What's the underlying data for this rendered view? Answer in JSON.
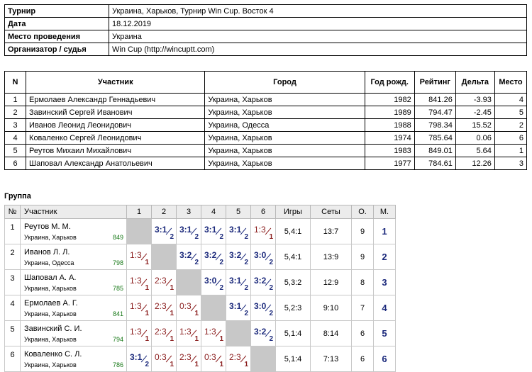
{
  "info": [
    {
      "label": "Турнир",
      "value": "Украина, Харьков, Турнир Win Cup. Восток 4"
    },
    {
      "label": "Дата",
      "value": "18.12.2019"
    },
    {
      "label": "Место проведения",
      "value": "Украина"
    },
    {
      "label": "Организатор / судья",
      "value": "Win Cup (http://wincuptt.com)"
    }
  ],
  "participants": {
    "headers": [
      "N",
      "Участник",
      "Город",
      "Год рожд.",
      "Рейтинг",
      "Дельта",
      "Место"
    ],
    "rows": [
      {
        "n": "1",
        "name": "Ермолаев Александр Геннадьевич",
        "city": "Украина, Харьков",
        "year": "1982",
        "rating": "841.26",
        "delta": "-3.93",
        "place": "4"
      },
      {
        "n": "2",
        "name": "Завинский Сергей Иванович",
        "city": "Украина, Харьков",
        "year": "1989",
        "rating": "794.47",
        "delta": "-2.45",
        "place": "5"
      },
      {
        "n": "3",
        "name": "Иванов Леонид Леонидович",
        "city": "Украина, Одесса",
        "year": "1988",
        "rating": "798.34",
        "delta": "15.52",
        "place": "2"
      },
      {
        "n": "4",
        "name": "Коваленко Сергей Леонидович",
        "city": "Украина, Харьков",
        "year": "1974",
        "rating": "785.64",
        "delta": "0.06",
        "place": "6"
      },
      {
        "n": "5",
        "name": "Реутов Михаил Михайлович",
        "city": "Украина, Харьков",
        "year": "1983",
        "rating": "849.01",
        "delta": "5.64",
        "place": "1"
      },
      {
        "n": "6",
        "name": "Шаповал Александр Анатольевич",
        "city": "Украина, Харьков",
        "year": "1977",
        "rating": "784.61",
        "delta": "12.26",
        "place": "3"
      }
    ]
  },
  "group": {
    "title": "Группа",
    "headers": [
      "№",
      "Участник",
      "1",
      "2",
      "3",
      "4",
      "5",
      "6",
      "Игры",
      "Сеты",
      "О.",
      "М."
    ],
    "rows": [
      {
        "n": "1",
        "name": "Реутов М. М.",
        "city": "Украина, Харьков",
        "rating": "849",
        "cells": [
          null,
          {
            "s": "3:1",
            "p": "2",
            "r": "win"
          },
          {
            "s": "3:1",
            "p": "2",
            "r": "win"
          },
          {
            "s": "3:1",
            "p": "2",
            "r": "win"
          },
          {
            "s": "3:1",
            "p": "2",
            "r": "win"
          },
          {
            "s": "1:3",
            "p": "1",
            "r": "loss"
          }
        ],
        "games": "5,4:1",
        "sets": "13:7",
        "points": "9",
        "place": "1"
      },
      {
        "n": "2",
        "name": "Иванов Л. Л.",
        "city": "Украина, Одесса",
        "rating": "798",
        "cells": [
          {
            "s": "1:3",
            "p": "1",
            "r": "loss"
          },
          null,
          {
            "s": "3:2",
            "p": "2",
            "r": "win"
          },
          {
            "s": "3:2",
            "p": "2",
            "r": "win"
          },
          {
            "s": "3:2",
            "p": "2",
            "r": "win"
          },
          {
            "s": "3:0",
            "p": "2",
            "r": "win"
          }
        ],
        "games": "5,4:1",
        "sets": "13:9",
        "points": "9",
        "place": "2"
      },
      {
        "n": "3",
        "name": "Шаповал А. А.",
        "city": "Украина, Харьков",
        "rating": "785",
        "cells": [
          {
            "s": "1:3",
            "p": "1",
            "r": "loss"
          },
          {
            "s": "2:3",
            "p": "1",
            "r": "loss"
          },
          null,
          {
            "s": "3:0",
            "p": "2",
            "r": "win"
          },
          {
            "s": "3:1",
            "p": "2",
            "r": "win"
          },
          {
            "s": "3:2",
            "p": "2",
            "r": "win"
          }
        ],
        "games": "5,3:2",
        "sets": "12:9",
        "points": "8",
        "place": "3"
      },
      {
        "n": "4",
        "name": "Ермолаев А. Г.",
        "city": "Украина, Харьков",
        "rating": "841",
        "cells": [
          {
            "s": "1:3",
            "p": "1",
            "r": "loss"
          },
          {
            "s": "2:3",
            "p": "1",
            "r": "loss"
          },
          {
            "s": "0:3",
            "p": "1",
            "r": "loss"
          },
          null,
          {
            "s": "3:1",
            "p": "2",
            "r": "win"
          },
          {
            "s": "3:0",
            "p": "2",
            "r": "win"
          }
        ],
        "games": "5,2:3",
        "sets": "9:10",
        "points": "7",
        "place": "4"
      },
      {
        "n": "5",
        "name": "Завинский С. И.",
        "city": "Украина, Харьков",
        "rating": "794",
        "cells": [
          {
            "s": "1:3",
            "p": "1",
            "r": "loss"
          },
          {
            "s": "2:3",
            "p": "1",
            "r": "loss"
          },
          {
            "s": "1:3",
            "p": "1",
            "r": "loss"
          },
          {
            "s": "1:3",
            "p": "1",
            "r": "loss"
          },
          null,
          {
            "s": "3:2",
            "p": "2",
            "r": "win"
          }
        ],
        "games": "5,1:4",
        "sets": "8:14",
        "points": "6",
        "place": "5"
      },
      {
        "n": "6",
        "name": "Коваленко С. Л.",
        "city": "Украина, Харьков",
        "rating": "786",
        "cells": [
          {
            "s": "3:1",
            "p": "2",
            "r": "win"
          },
          {
            "s": "0:3",
            "p": "1",
            "r": "loss"
          },
          {
            "s": "2:3",
            "p": "1",
            "r": "loss"
          },
          {
            "s": "0:3",
            "p": "1",
            "r": "loss"
          },
          {
            "s": "2:3",
            "p": "1",
            "r": "loss"
          },
          null
        ],
        "games": "5,1:4",
        "sets": "7:13",
        "points": "6",
        "place": "6"
      }
    ]
  }
}
